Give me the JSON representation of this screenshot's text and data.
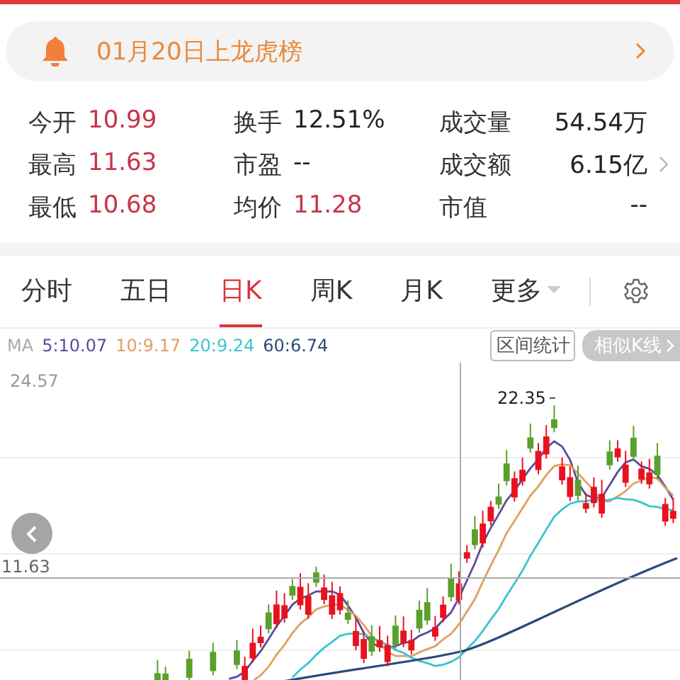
{
  "alert_banner": {
    "text": "01月20日上龙虎榜"
  },
  "quote_stats": {
    "rows": [
      {
        "cells": [
          {
            "label": "今开",
            "value": "10.99",
            "rising": true
          },
          {
            "label": "换手",
            "value": "12.51%",
            "rising": false
          },
          {
            "label": "成交量",
            "value": "54.54万",
            "rising": false
          }
        ],
        "has_arrow": false
      },
      {
        "cells": [
          {
            "label": "最高",
            "value": "11.63",
            "rising": true
          },
          {
            "label": "市盈",
            "value": "--",
            "rising": false
          },
          {
            "label": "成交额",
            "value": "6.15亿",
            "rising": false
          }
        ],
        "has_arrow": true
      },
      {
        "cells": [
          {
            "label": "最低",
            "value": "10.68",
            "rising": true
          },
          {
            "label": "均价",
            "value": "11.28",
            "rising": true
          },
          {
            "label": "市值",
            "value": "--",
            "rising": false
          }
        ],
        "has_arrow": false
      }
    ]
  },
  "period_tabs": [
    {
      "label": "分时",
      "selected": false,
      "kind": "tab"
    },
    {
      "label": "五日",
      "selected": false,
      "kind": "tab"
    },
    {
      "label": "日K",
      "selected": true,
      "kind": "tab"
    },
    {
      "label": "周K",
      "selected": false,
      "kind": "tab"
    },
    {
      "label": "月K",
      "selected": false,
      "kind": "tab"
    },
    {
      "label": "更多",
      "selected": false,
      "kind": "dropdown"
    }
  ],
  "indicators": {
    "name": "MA",
    "lines": [
      {
        "label": "5:10.07",
        "color": "#5b4aa0"
      },
      {
        "label": "10:9.17",
        "color": "#e0a060"
      },
      {
        "label": "20:9.24",
        "color": "#3cc4cc"
      },
      {
        "label": "60:6.74",
        "color": "#2a4a7a"
      }
    ]
  },
  "chart_buttons": [
    {
      "label": "区间统计",
      "kind": "outline"
    },
    {
      "label": "相似K线",
      "kind": "pill"
    }
  ],
  "chart": {
    "top_price": "24.57",
    "crosshair_price": "11.63",
    "peak_label": "22.35"
  }
}
